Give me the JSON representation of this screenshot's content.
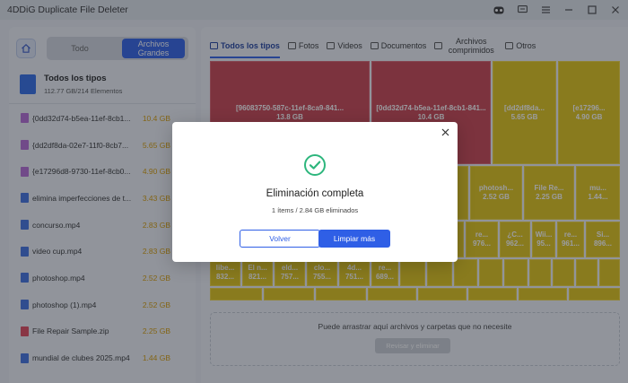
{
  "app": {
    "title": "4DDiG Duplicate File Deleter"
  },
  "left": {
    "toggle": {
      "all": "Todo",
      "large": "Archivos Grandes"
    },
    "summary": {
      "name": "Todos los tipos",
      "sub": "112.77 GB/214 Elementos"
    },
    "files": [
      {
        "name": "{0dd32d74-b5ea-11ef-8cb1...",
        "size": "10.4 GB",
        "icon": "compressed",
        "color": "#b46ad6"
      },
      {
        "name": "{dd2df8da-02e7-11f0-8cb7...",
        "size": "5.65 GB",
        "icon": "compressed",
        "color": "#b46ad6"
      },
      {
        "name": "{e17296d8-9730-11ef-8cb0...",
        "size": "4.90 GB",
        "icon": "compressed",
        "color": "#b46ad6"
      },
      {
        "name": "elimina imperfecciones de t...",
        "size": "3.43 GB",
        "icon": "video",
        "color": "#3f6fe0"
      },
      {
        "name": "concurso.mp4",
        "size": "2.83 GB",
        "icon": "video",
        "color": "#3f6fe0"
      },
      {
        "name": "video cup.mp4",
        "size": "2.83 GB",
        "icon": "video",
        "color": "#3f6fe0"
      },
      {
        "name": "photoshop.mp4",
        "size": "2.52 GB",
        "icon": "video",
        "color": "#3f6fe0"
      },
      {
        "name": "photoshop (1).mp4",
        "size": "2.52 GB",
        "icon": "video",
        "color": "#3f6fe0"
      },
      {
        "name": "File Repair Sample.zip",
        "size": "2.25 GB",
        "icon": "zip",
        "color": "#e0455a"
      },
      {
        "name": "mundial de clubes 2025.mp4",
        "size": "1.44 GB",
        "icon": "video",
        "color": "#3f6fe0"
      }
    ]
  },
  "tabs": [
    {
      "label": "Todos los tipos",
      "icon": "grid-icon",
      "active": true
    },
    {
      "label": "Fotos",
      "icon": "image-icon",
      "active": false
    },
    {
      "label": "Videos",
      "icon": "play-icon",
      "active": false
    },
    {
      "label": "Documentos",
      "icon": "folder-icon",
      "active": false
    },
    {
      "label": "Archivos comprimidos",
      "icon": "archive-icon",
      "active": false
    },
    {
      "label": "Otros",
      "icon": "other-icon",
      "active": false
    }
  ],
  "treemap": {
    "big": [
      {
        "label": "[96083750-587c-11ef-8ca9-841...",
        "size": "13.8 GB",
        "color": "red"
      },
      {
        "label": "[0dd32d74-b5ea-11ef-8cb1-841...",
        "size": "10.4 GB",
        "color": "red"
      },
      {
        "label": "[dd2df8da...",
        "size": "5.65 GB",
        "color": "yellow"
      },
      {
        "label": "[e17296...",
        "size": "4.90 GB",
        "color": "yellow"
      }
    ],
    "mid": [
      {
        "label": "photosh...",
        "size": "2.52 GB"
      },
      {
        "label": "File Re...",
        "size": "2.25 GB"
      },
      {
        "label": "mu...",
        "size": "1.44..."
      }
    ],
    "small_row1": [
      {
        "label": "re...",
        "size": "976..."
      },
      {
        "label": "¿C...",
        "size": "962..."
      },
      {
        "label": "Wii...",
        "size": "95..."
      },
      {
        "label": "re...",
        "size": "961..."
      },
      {
        "label": "Si...",
        "size": "896..."
      }
    ],
    "small_row2": [
      {
        "label": "libe...",
        "size": "832..."
      },
      {
        "label": "El n...",
        "size": "821..."
      },
      {
        "label": "eld...",
        "size": "757..."
      },
      {
        "label": "clo...",
        "size": "755..."
      },
      {
        "label": "4d...",
        "size": "751..."
      },
      {
        "label": "re...",
        "size": "689..."
      }
    ]
  },
  "dropzone": {
    "text": "Puede arrastrar aquí archivos y carpetas que no necesite",
    "button": "Revisar y eliminar"
  },
  "dialog": {
    "title": "Eliminación completa",
    "subtitle": "1 ítems / 2.84 GB eliminados",
    "back": "Volver",
    "clean": "Limpiar más",
    "accent": "#2f5fe6",
    "success": "#2eb67d"
  }
}
